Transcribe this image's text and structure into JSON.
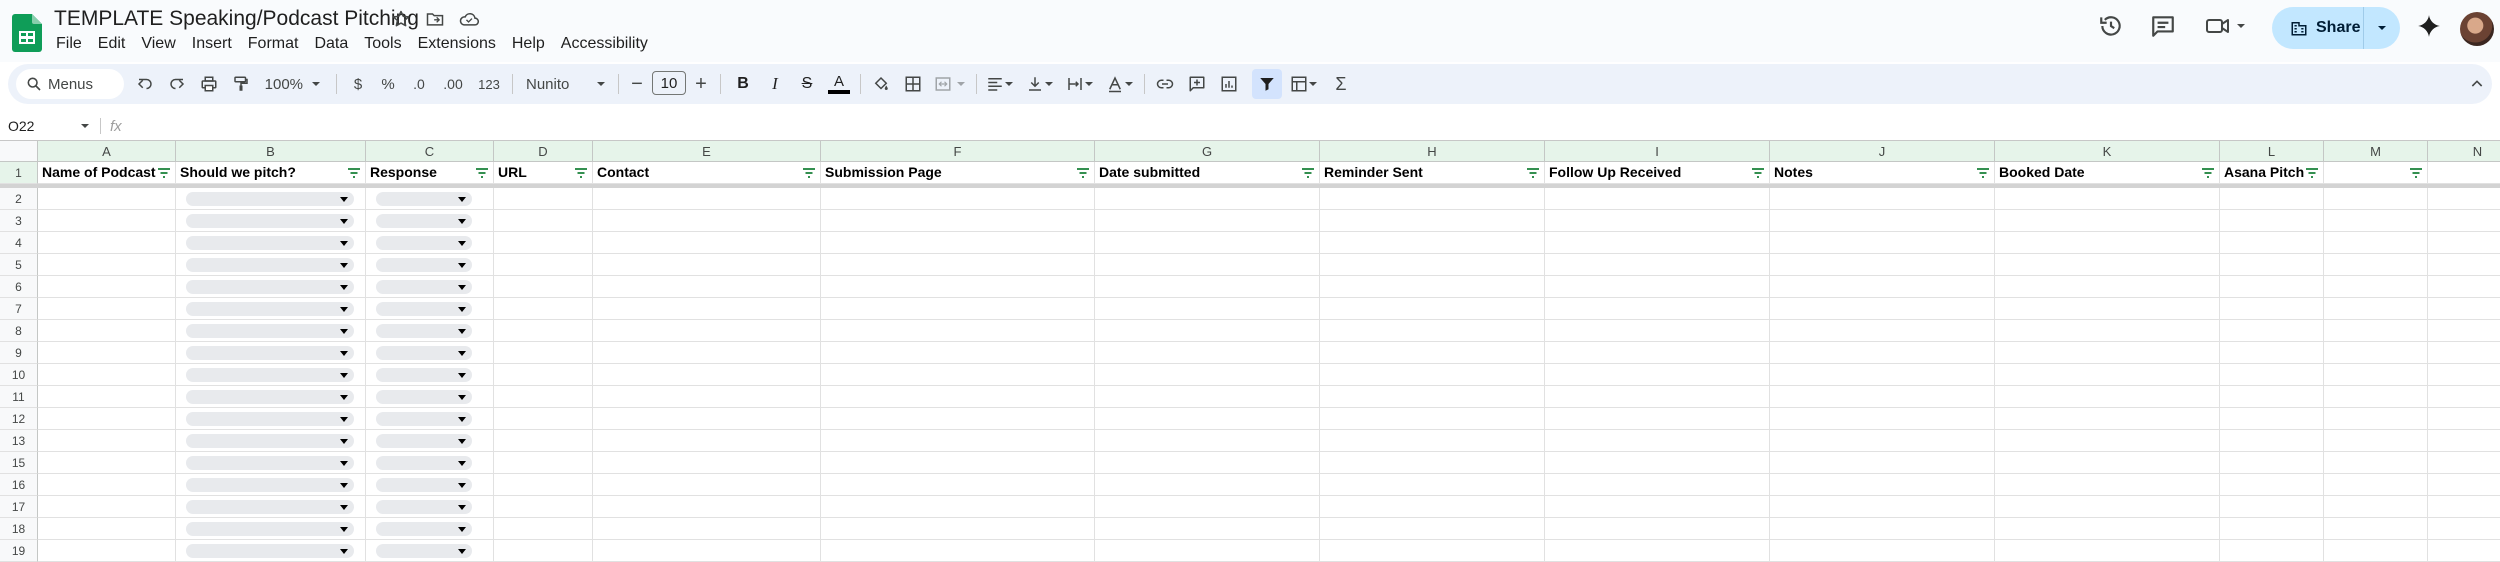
{
  "doc": {
    "title": "TEMPLATE Speaking/Podcast Pitching"
  },
  "menu": [
    "File",
    "Edit",
    "View",
    "Insert",
    "Format",
    "Data",
    "Tools",
    "Extensions",
    "Help",
    "Accessibility"
  ],
  "share": {
    "label": "Share"
  },
  "toolbar": {
    "menus_label": "Menus",
    "zoom": "100%",
    "currency": "$",
    "percent": "%",
    "dec_decrease": ".0",
    "dec_increase": ".00",
    "more_formats": "123",
    "font": "Nunito",
    "font_size": "10",
    "sum": "Σ"
  },
  "formula_bar": {
    "cell_ref": "O22",
    "fx": "fx"
  },
  "colors": {
    "accent": "#c2e7ff",
    "header_green": "#e6f4ea",
    "sheets_green": "#0f9d58"
  },
  "sheet": {
    "col_letters": [
      "A",
      "B",
      "C",
      "D",
      "E",
      "F",
      "G",
      "H",
      "I",
      "J",
      "K",
      "L",
      "M",
      "N"
    ],
    "headers": [
      "Name of Podcast",
      "Should we pitch?",
      "Response",
      "URL",
      "Contact",
      "Submission Page",
      "Date submitted",
      "Reminder Sent",
      "Follow Up Received",
      "Notes",
      "Booked Date",
      "Asana Pitch",
      "",
      ""
    ],
    "row_numbers": [
      "1",
      "2",
      "3",
      "4",
      "5",
      "6",
      "7",
      "8",
      "9",
      "10",
      "11",
      "12",
      "13",
      "15",
      "16",
      "17",
      "18",
      "19"
    ]
  }
}
